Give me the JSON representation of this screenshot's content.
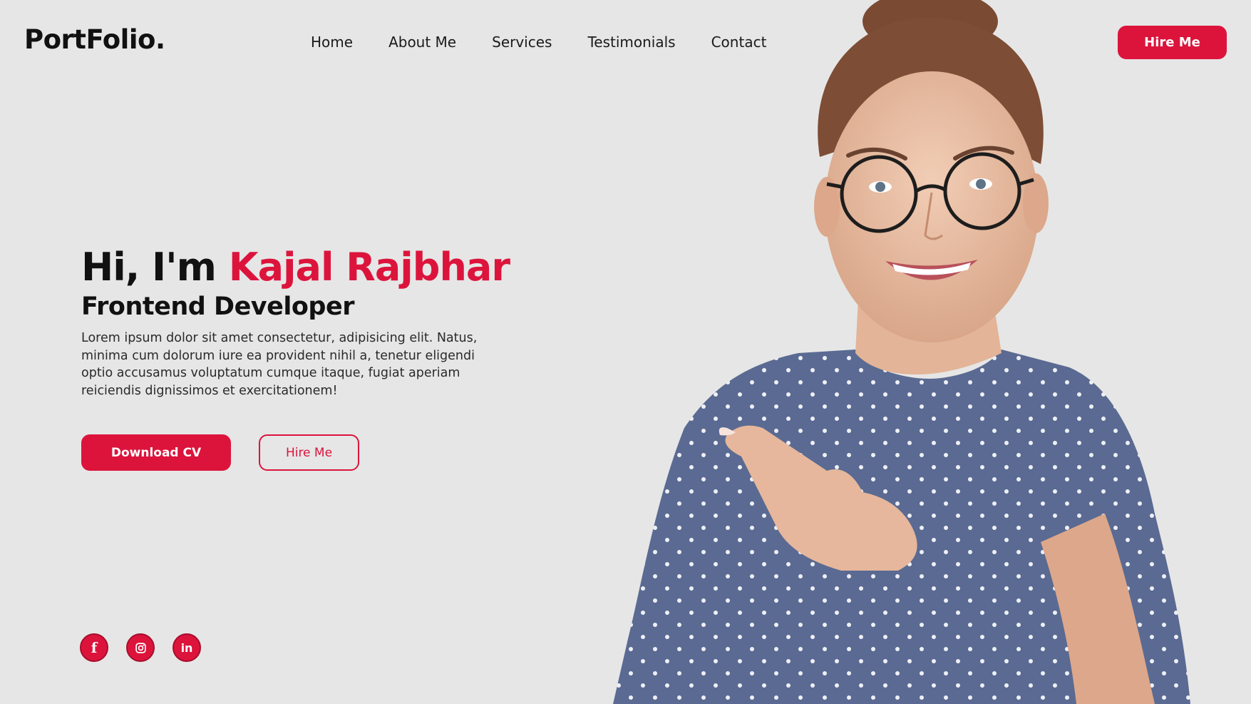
{
  "header": {
    "logo": "PortFolio.",
    "nav": [
      {
        "label": "Home"
      },
      {
        "label": "About Me"
      },
      {
        "label": "Services"
      },
      {
        "label": "Testimonials"
      },
      {
        "label": "Contact"
      }
    ],
    "cta_label": "Hire Me"
  },
  "hero": {
    "greeting": "Hi, I'm ",
    "name": "Kajal Rajbhar",
    "role": "Frontend Developer",
    "description": "Lorem ipsum dolor sit amet consectetur, adipisicing elit. Natus, minima cum dolorum iure ea provident nihil a, tenetur eligendi optio accusamus voluptatum cumque itaque, fugiat aperiam reiciendis dignissimos et exercitationem!",
    "download_label": "Download CV",
    "hire_label": "Hire Me"
  },
  "socials": [
    {
      "icon": "facebook-icon",
      "glyph": "f"
    },
    {
      "icon": "instagram-icon",
      "glyph": ""
    },
    {
      "icon": "linkedin-icon",
      "glyph": "in"
    }
  ],
  "colors": {
    "accent": "#dc143c",
    "background": "#e6e6e6",
    "text": "#111111"
  }
}
